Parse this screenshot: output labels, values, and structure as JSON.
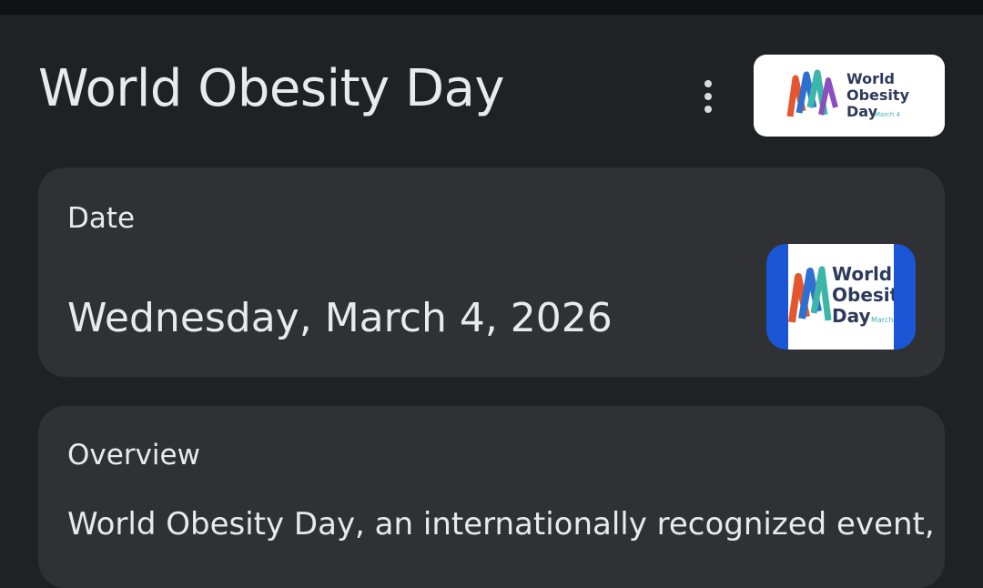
{
  "header": {
    "title": "World Obesity Day",
    "more_icon": "more-vert-icon"
  },
  "logo": {
    "line1": "World",
    "line2": "Obesity",
    "line3": "Day",
    "tag": "March 4",
    "colors": [
      "#e4572e",
      "#2f6fd1",
      "#3cb6a9",
      "#8a4fbf",
      "#f2a33a",
      "#d93f7e"
    ]
  },
  "date_card": {
    "label": "Date",
    "value": "Wednesday, March 4, 2026",
    "thumb_bg": "#1a56d6"
  },
  "overview_card": {
    "label": "Overview",
    "text": "World Obesity Day, an internationally recognized event,"
  },
  "theme": {
    "background": "#202124",
    "card": "#303134",
    "text": "#e8eaed"
  }
}
